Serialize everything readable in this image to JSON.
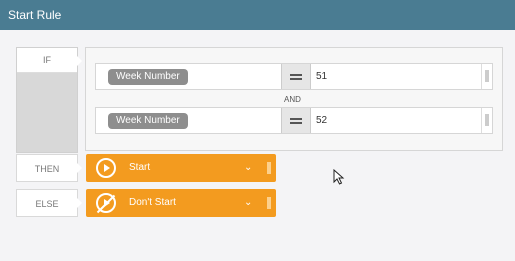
{
  "title": "Start Rule",
  "if_label": "IF",
  "then_label": "THEN",
  "else_label": "ELSE",
  "conditions": [
    {
      "field": "Week Number",
      "operator": "=",
      "value": "51"
    },
    {
      "field": "Week Number",
      "operator": "=",
      "value": "52"
    }
  ],
  "connector": "AND",
  "then_action": {
    "label": "Start",
    "icon": "play-icon"
  },
  "else_action": {
    "label": "Don't Start",
    "icon": "no-play-icon"
  },
  "colors": {
    "titlebar": "#4a7c92",
    "action": "#f39b1f",
    "field_pill": "#8e8e8e"
  }
}
